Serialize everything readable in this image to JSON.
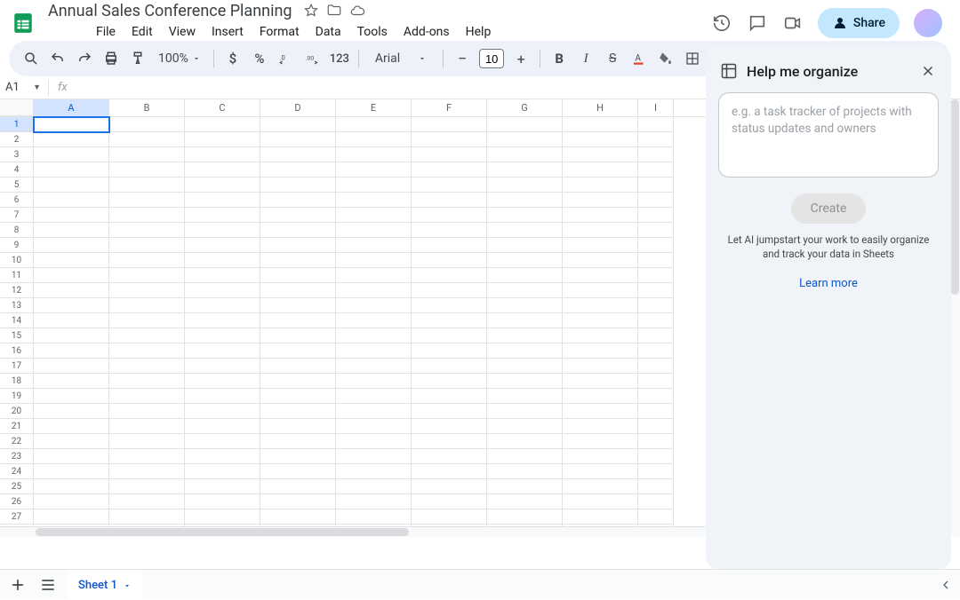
{
  "doc": {
    "title": "Annual Sales Conference Planning"
  },
  "menus": [
    "File",
    "Edit",
    "View",
    "Insert",
    "Format",
    "Data",
    "Tools",
    "Add-ons",
    "Help"
  ],
  "toolbar": {
    "zoom": "100%",
    "font": "Arial",
    "fontsize": "10",
    "number_label": "123"
  },
  "namebox": {
    "ref": "A1"
  },
  "columns": [
    "A",
    "B",
    "C",
    "D",
    "E",
    "F",
    "G",
    "H",
    "I"
  ],
  "rows": 28,
  "share": {
    "label": "Share"
  },
  "side": {
    "title": "Help me organize",
    "placeholder": "e.g. a task tracker of projects with status updates and owners",
    "create": "Create",
    "hint": "Let AI jumpstart your work to easily organize and track your data in Sheets",
    "learn": "Learn more"
  },
  "tabs": {
    "sheet1": "Sheet 1"
  }
}
